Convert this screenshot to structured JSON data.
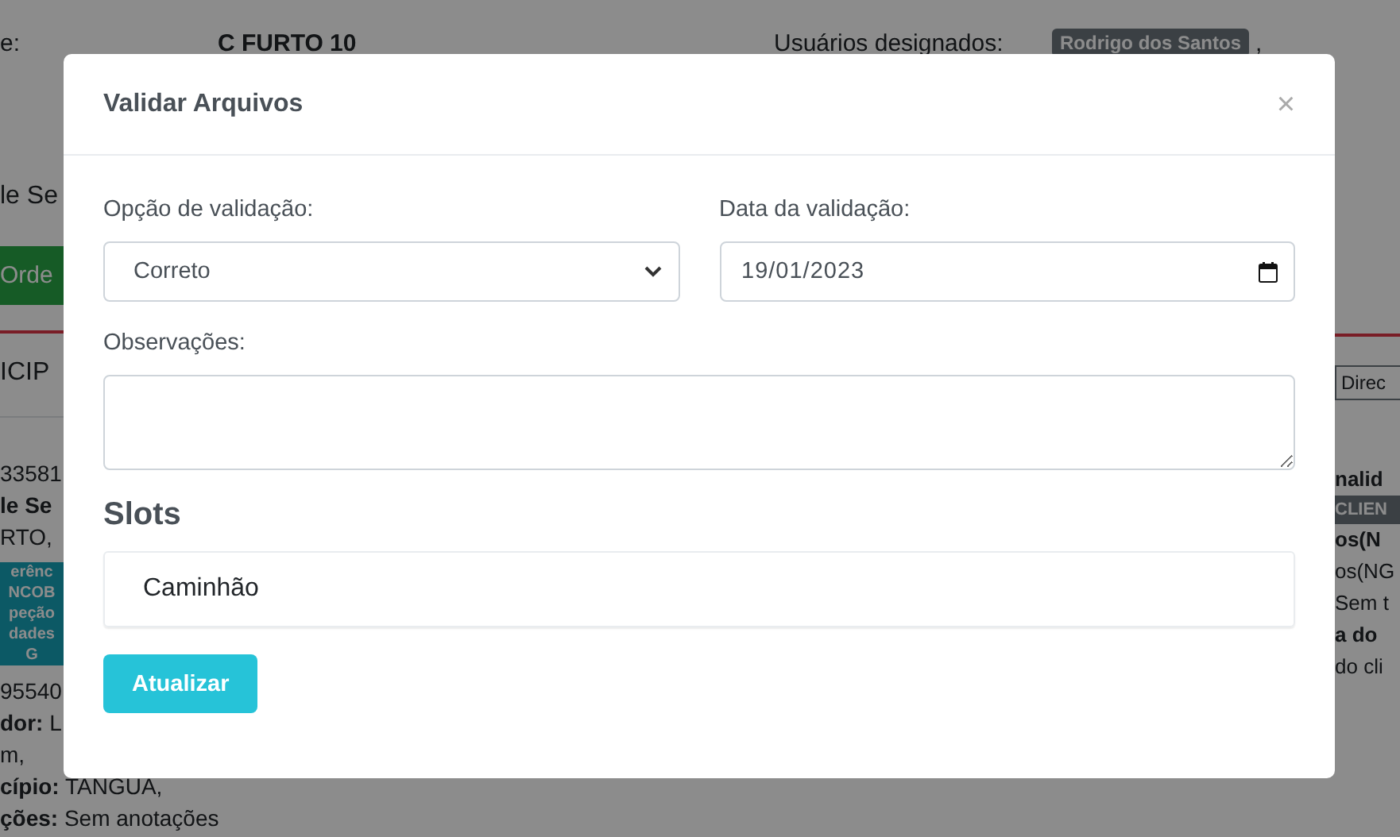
{
  "background": {
    "header": {
      "label_fragment": "e:",
      "order_name": "C FURTO 10",
      "assigned_label": "Usuários designados:",
      "assigned_user": "Rodrigo dos Santos",
      "separator": ","
    },
    "left": [
      {
        "kind": "heading",
        "text": "le Se"
      },
      {
        "kind": "button",
        "text": "Orde"
      },
      {
        "kind": "rule"
      },
      {
        "kind": "section",
        "text": "ICIP"
      },
      {
        "kind": "text",
        "text": "33581"
      },
      {
        "kind": "bold",
        "text": "le Se"
      },
      {
        "kind": "text",
        "text": "RTO,"
      },
      {
        "kind": "badge",
        "lines": [
          "erênc",
          "NCOB",
          "peção",
          "dades",
          "G"
        ]
      },
      {
        "kind": "text",
        "text": "95540"
      },
      {
        "kind": "pair",
        "label": "dor:",
        "value": "L"
      },
      {
        "kind": "text",
        "text": "m,"
      },
      {
        "kind": "pair",
        "label": "cípio:",
        "value": "TANGUA,"
      },
      {
        "kind": "pair",
        "label": "ções:",
        "value": "Sem anotações"
      }
    ],
    "right": [
      {
        "kind": "rule"
      },
      {
        "kind": "button",
        "text": "Direc"
      },
      {
        "kind": "bold",
        "text": "nalid"
      },
      {
        "kind": "badge",
        "lines": [
          "CLIEN"
        ]
      },
      {
        "kind": "bold",
        "text": "os(N"
      },
      {
        "kind": "text",
        "text": "os(NG"
      },
      {
        "kind": "text",
        "text": "Sem t"
      },
      {
        "kind": "bold",
        "text": "a do"
      },
      {
        "kind": "text",
        "text": "do cli"
      }
    ]
  },
  "modal": {
    "title": "Validar Arquivos",
    "close": "×",
    "fields": [
      {
        "label": "Opção de validação:",
        "kind": "select",
        "value": "Correto"
      },
      {
        "label": "Data da validação:",
        "kind": "date",
        "value": "19/01/2023"
      }
    ],
    "observations": {
      "label": "Observações:"
    },
    "slots_heading": "Slots",
    "slots": [
      {
        "name": "Caminhão"
      }
    ],
    "submit": "Atualizar"
  }
}
